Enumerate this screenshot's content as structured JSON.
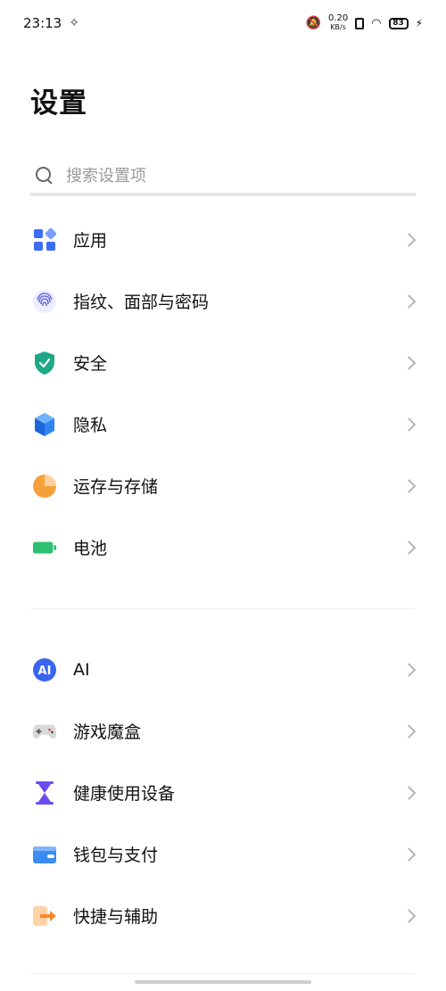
{
  "status": {
    "time": "23:13",
    "net_speed_top": "0.20",
    "net_speed_bottom": "KB/s",
    "battery": "83"
  },
  "header": {
    "title": "设置"
  },
  "search": {
    "placeholder": "搜索设置项"
  },
  "group1": {
    "items": [
      {
        "label": "应用",
        "icon": "apps-icon"
      },
      {
        "label": "指纹、面部与密码",
        "icon": "fingerprint-icon"
      },
      {
        "label": "安全",
        "icon": "shield-icon"
      },
      {
        "label": "隐私",
        "icon": "privacy-cube-icon"
      },
      {
        "label": "运存与存储",
        "icon": "storage-pie-icon"
      },
      {
        "label": "电池",
        "icon": "battery-icon"
      }
    ]
  },
  "group2": {
    "items": [
      {
        "label": "AI",
        "icon": "ai-icon"
      },
      {
        "label": "游戏魔盒",
        "icon": "game-controller-icon"
      },
      {
        "label": "健康使用设备",
        "icon": "hourglass-icon"
      },
      {
        "label": "钱包与支付",
        "icon": "wallet-icon"
      },
      {
        "label": "快捷与辅助",
        "icon": "shortcut-arrow-icon"
      }
    ]
  },
  "colors": {
    "apps": "#3b6cf5",
    "fingerprint": "#6b6fe0",
    "shield": "#1fa887",
    "privacy": "#2f84f0",
    "storage": "#f5a03a",
    "battery": "#2fbf71",
    "ai": "#3a64f0",
    "hourglass": "#6c4cf0",
    "wallet": "#3a8bf2",
    "shortcut": "#f58a2b"
  }
}
